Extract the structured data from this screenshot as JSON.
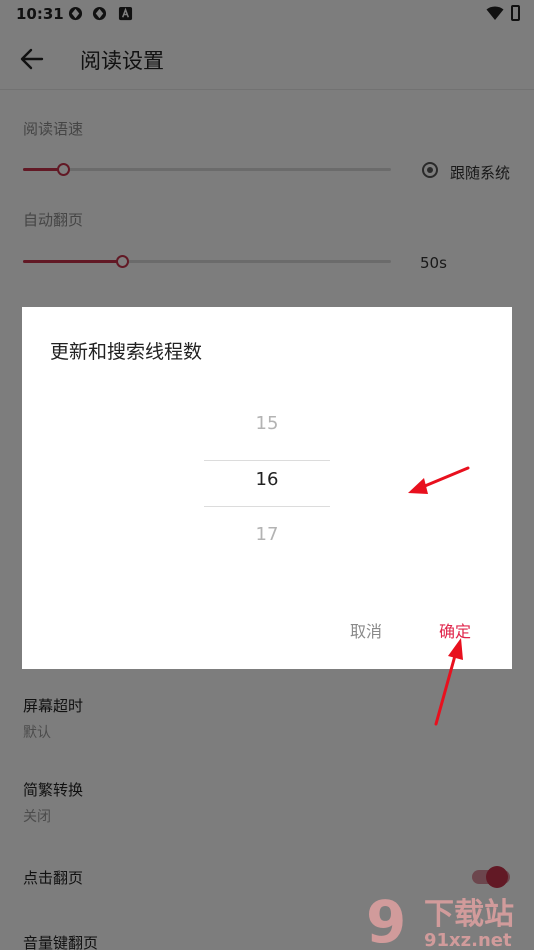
{
  "status_bar": {
    "time": "10:31"
  },
  "toolbar": {
    "title": "阅读设置"
  },
  "settings": {
    "read_speed_label": "阅读语速",
    "follow_system_label": "跟随系统",
    "auto_page_label": "自动翻页",
    "auto_page_value": "50s",
    "read_speed_level": 0.11,
    "auto_page_level": 0.27,
    "screen_timeout_title": "屏幕超时",
    "screen_timeout_value": "默认",
    "chinese_convert_title": "简繁转换",
    "chinese_convert_value": "关闭",
    "tap_page_title": "点击翻页",
    "tap_page_enabled": true,
    "volume_key_title": "音量键翻页"
  },
  "dialog": {
    "title": "更新和搜索线程数",
    "picker_values": [
      "15",
      "16",
      "17"
    ],
    "selected_value": "16",
    "cancel_label": "取消",
    "confirm_label": "确定"
  },
  "watermark": {
    "logo_text": "9下载站",
    "url_text": "91xz.net"
  },
  "colors": {
    "accent": "#c4334b",
    "confirm": "#e0254b",
    "annotation_arrow": "#e8101e"
  }
}
